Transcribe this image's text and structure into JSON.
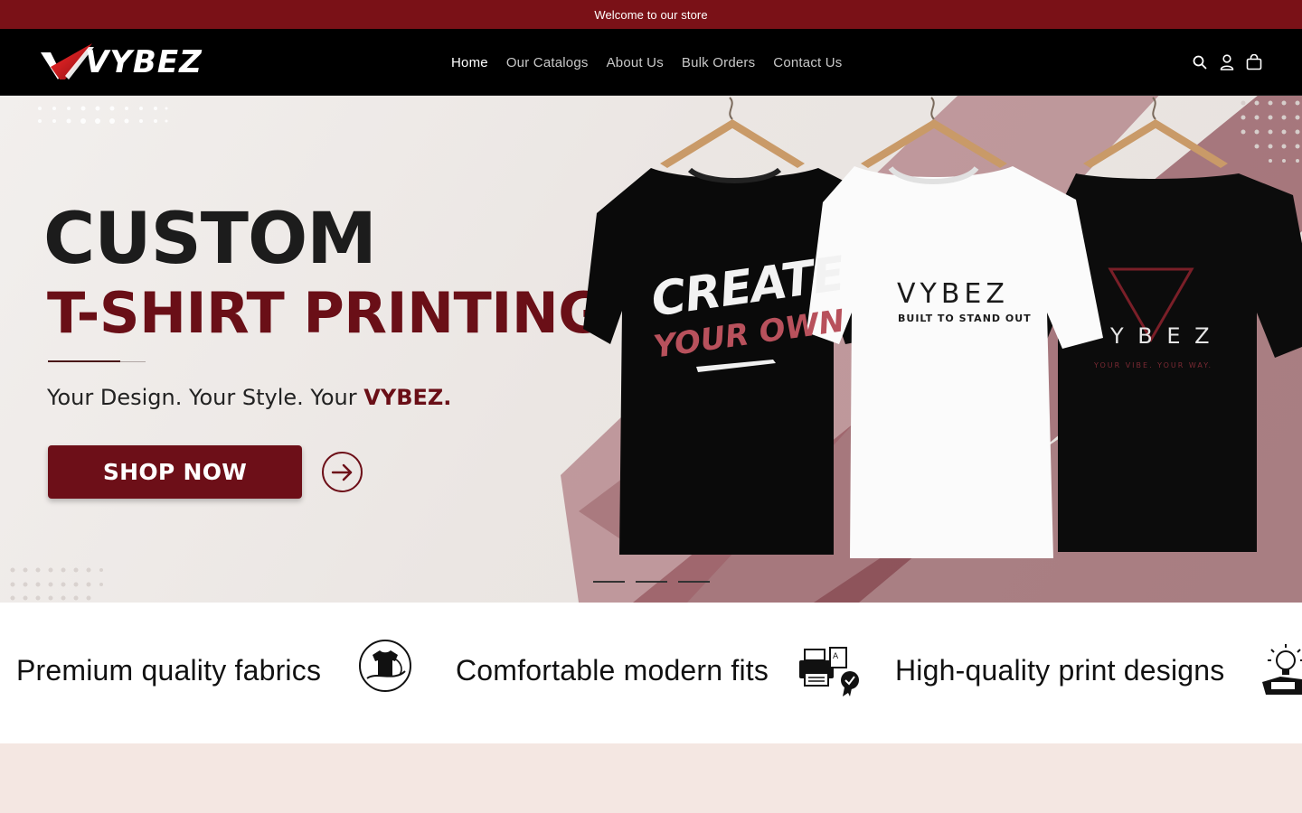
{
  "announcement": {
    "text": "Welcome to our store"
  },
  "header": {
    "logo_text": "VYBEZ",
    "nav": [
      {
        "label": "Home",
        "active": true
      },
      {
        "label": "Our Catalogs",
        "active": false
      },
      {
        "label": "About Us",
        "active": false
      },
      {
        "label": "Bulk Orders",
        "active": false
      },
      {
        "label": "Contact Us",
        "active": false
      }
    ],
    "icons": [
      "search-icon",
      "account-icon",
      "cart-icon"
    ]
  },
  "hero": {
    "title_line1": "CUSTOM",
    "title_line2": "T-SHIRT PRINTING",
    "tagline_prefix": "Your Design. Your Style. Your ",
    "tagline_brand": "VYBEZ.",
    "cta_label": "SHOP NOW",
    "shirts": {
      "shirt1_line1": "CREATE",
      "shirt1_line2": "YOUR OWN",
      "shirt2_brand": "VYBEZ",
      "shirt2_sub": "BUILT TO STAND OUT",
      "shirt3_brand": "Y B E Z",
      "shirt3_sub": "YOUR VIBE. YOUR WAY."
    },
    "slides": 3,
    "active_slide": 1
  },
  "features": [
    {
      "text": "Premium quality fabrics",
      "icon": "fabric-tshirt-icon"
    },
    {
      "text": "Comfortable modern fits",
      "icon": "printer-quality-icon"
    },
    {
      "text": "High-quality print designs",
      "icon": "creative-design-icon"
    }
  ],
  "colors": {
    "accent": "#7a1117",
    "header_bg": "#000000",
    "hero_red": "#6a0f17",
    "bottom_band": "#f4e7e2"
  }
}
